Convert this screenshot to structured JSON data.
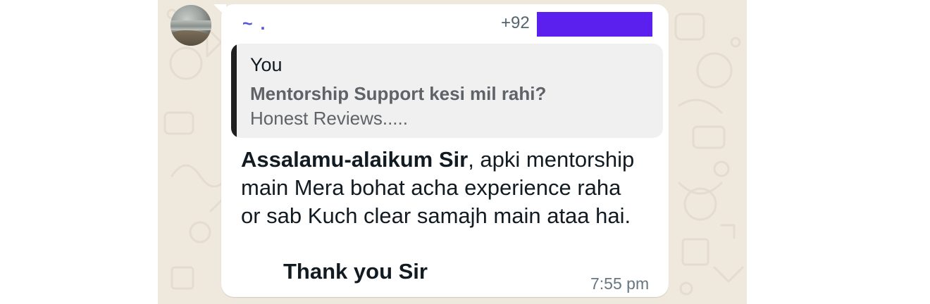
{
  "sender": {
    "name": "~ .",
    "phone_prefix": "+92"
  },
  "quote": {
    "author": "You",
    "line1": "Mentorship Support kesi mil rahi?",
    "line2": "Honest Reviews....."
  },
  "message": {
    "greeting": "Assalamu-alaikum Sir",
    "body_rest": ", apki mentorship main Mera bohat acha experience raha or sab Kuch clear samajh main ataa hai.",
    "thanks": "Thank you Sir",
    "time": "7:55 pm"
  },
  "colors": {
    "chat_background": "#efe8dc",
    "sender_name": "#5856d6",
    "redaction": "#5b20ee",
    "quote_bar": "#1f1f1f",
    "quote_background": "#f0f0f0"
  }
}
